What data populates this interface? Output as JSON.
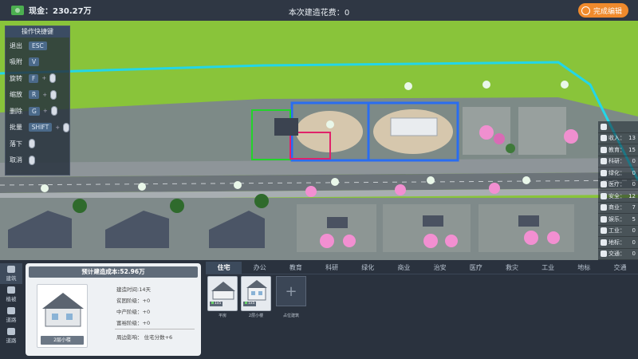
{
  "topbar": {
    "cash_label": "现金：",
    "cash_value": "230.27万",
    "build_cost_label": "本次建造花费：",
    "build_cost_value": "0",
    "finish_button": "完成编辑"
  },
  "controls": {
    "title": "操作快捷键",
    "rows": [
      {
        "label": "退出",
        "key": "ESC",
        "mouse": false
      },
      {
        "label": "吸附",
        "key": "V",
        "mouse": false
      },
      {
        "label": "旋转",
        "key": "F",
        "mouse": true
      },
      {
        "label": "缩放",
        "key": "R",
        "mouse": true
      },
      {
        "label": "删除",
        "key": "G",
        "mouse": true
      },
      {
        "label": "批量",
        "key": "SHIFT",
        "mouse": true
      },
      {
        "label": "落下",
        "key": "",
        "mouse": true
      },
      {
        "label": "取消",
        "key": "",
        "mouse": true
      }
    ]
  },
  "stats": [
    {
      "icon": "people-icon",
      "label": "",
      "value": ""
    },
    {
      "icon": "info-icon",
      "label": "收入：",
      "value": "13"
    },
    {
      "icon": "happy-icon",
      "label": "教育：",
      "value": "15"
    },
    {
      "icon": "research-icon",
      "label": "科研：",
      "value": "0"
    },
    {
      "icon": "leaf-icon",
      "label": "绿化：",
      "value": "0"
    },
    {
      "icon": "hospital-icon",
      "label": "医疗：",
      "value": "0"
    },
    {
      "icon": "shield-icon",
      "label": "安全：",
      "value": "12"
    },
    {
      "icon": "shop-icon",
      "label": "商业：",
      "value": "7"
    },
    {
      "icon": "fun-icon",
      "label": "娱乐：",
      "value": "5"
    },
    {
      "icon": "industry-icon",
      "label": "工业：",
      "value": "0"
    },
    {
      "icon": "land-icon",
      "label": "地标：",
      "value": "0"
    },
    {
      "icon": "traffic-icon",
      "label": "交通：",
      "value": "0"
    }
  ],
  "leftnav": [
    {
      "label": "建筑",
      "active": true
    },
    {
      "label": "植被",
      "active": false
    },
    {
      "label": "道路",
      "active": false
    },
    {
      "label": "道路",
      "active": false
    }
  ],
  "infocard": {
    "cost_header": "预计建造成本:52.96万",
    "thumb_name": "2层小楼",
    "lines": [
      "建造时间:14天",
      "贫困阶级：+0",
      "中产阶级：+0",
      "富裕阶级：+0"
    ],
    "effect": "周边影响：  住宅分数+6"
  },
  "tabs": [
    {
      "label": "住宅",
      "active": true
    },
    {
      "label": "办公",
      "active": false
    },
    {
      "label": "教育",
      "active": false
    },
    {
      "label": "科研",
      "active": false
    },
    {
      "label": "绿化",
      "active": false
    },
    {
      "label": "商业",
      "active": false
    },
    {
      "label": "治安",
      "active": false
    },
    {
      "label": "医疗",
      "active": false
    },
    {
      "label": "救灾",
      "active": false
    },
    {
      "label": "工业",
      "active": false
    },
    {
      "label": "地标",
      "active": false
    },
    {
      "label": "交通",
      "active": false
    }
  ],
  "buildings": [
    {
      "label": "平房",
      "badge": "1x5"
    },
    {
      "label": "2层小楼",
      "badge": "1x5"
    }
  ],
  "add_building_label": "+",
  "add_building_caption": "占位建筑"
}
